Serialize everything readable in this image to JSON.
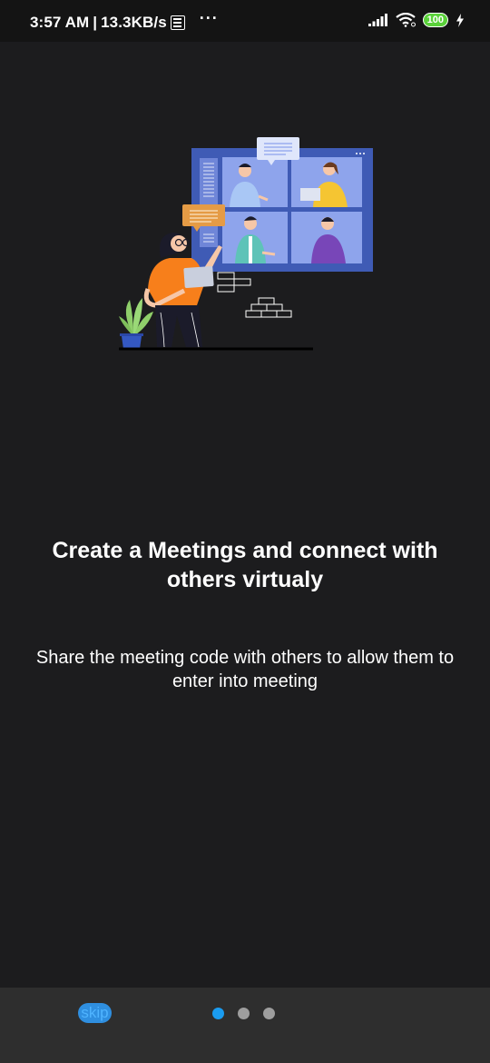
{
  "status_bar": {
    "time": "3:57 AM",
    "separator": "|",
    "network_speed": "13.3KB/s",
    "more": "···",
    "battery_level": "100",
    "icons": [
      "calculator-icon",
      "more-dots-icon",
      "signal-icon",
      "wifi-icon",
      "battery-icon",
      "charging-bolt-icon"
    ]
  },
  "onboarding": {
    "title": "Create a Meetings and connect with others virtualy",
    "subtitle": "Share the meeting code with others to allow them to enter into meeting"
  },
  "footer": {
    "skip_label": "skip",
    "pages": 3,
    "active_page": 1
  },
  "colors": {
    "background": "#1c1c1e",
    "footer": "#2e2e2e",
    "accent": "#1a9cf0",
    "dot_inactive": "#9e9e9e",
    "screen": "#3f5bb5",
    "shirt": "#f77f1b"
  }
}
